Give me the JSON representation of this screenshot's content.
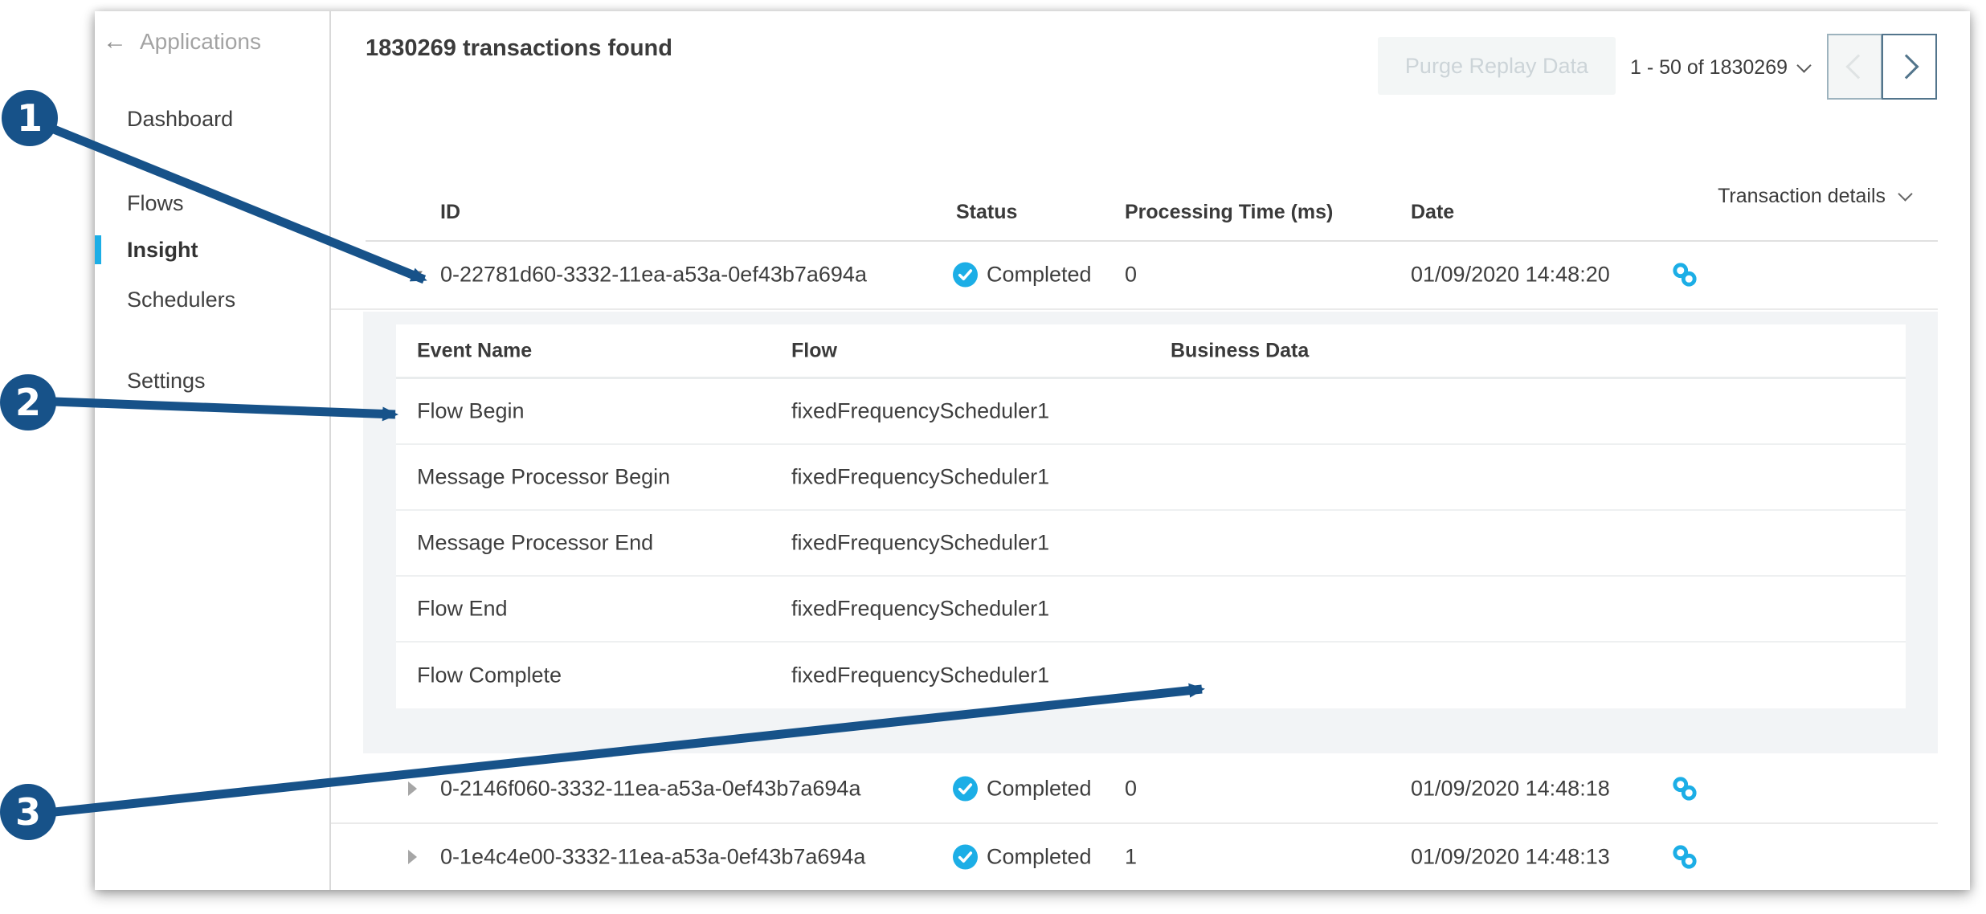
{
  "colors": {
    "accent_cyan": "#1caee6",
    "annotation_blue": "#175289",
    "status_completed_color": "#1caee6"
  },
  "icons": {
    "back": "arrow-left",
    "expand": "caret-down",
    "collapse": "caret-right",
    "status": "check-circle",
    "link": "chain-link",
    "dropdown": "chevron-down",
    "prev": "chevron-left",
    "next": "chevron-right"
  },
  "annotations": {
    "items": [
      {
        "label": "1"
      },
      {
        "label": "2"
      },
      {
        "label": "3"
      }
    ]
  },
  "sidebar": {
    "back": {
      "icon_glyph": "←",
      "label": "Applications"
    },
    "items": [
      {
        "label": "Dashboard",
        "active": false
      },
      {
        "label": "Flows",
        "active": false
      },
      {
        "label": "Insight",
        "active": true
      },
      {
        "label": "Schedulers",
        "active": false
      },
      {
        "label": "Settings",
        "active": false
      }
    ]
  },
  "toolbar": {
    "title": "1830269 transactions found",
    "purge_label": "Purge Replay Data",
    "pagination_label": "1 - 50 of 1830269"
  },
  "table": {
    "transaction_details_label": "Transaction details",
    "columns": {
      "id": "ID",
      "status": "Status",
      "processing_time": "Processing Time (ms)",
      "date": "Date"
    },
    "rows": [
      {
        "id": "0-22781d60-3332-11ea-a53a-0ef43b7a694a",
        "status": "Completed",
        "processing_time": "0",
        "date": "01/09/2020 14:48:20",
        "expanded": true
      },
      {
        "id": "0-2146f060-3332-11ea-a53a-0ef43b7a694a",
        "status": "Completed",
        "processing_time": "0",
        "date": "01/09/2020 14:48:18",
        "expanded": false
      },
      {
        "id": "0-1e4c4e00-3332-11ea-a53a-0ef43b7a694a",
        "status": "Completed",
        "processing_time": "1",
        "date": "01/09/2020 14:48:13",
        "expanded": false
      }
    ]
  },
  "events": {
    "columns": {
      "event": "Event Name",
      "flow": "Flow",
      "business_data": "Business Data"
    },
    "rows": [
      {
        "event": "Flow Begin",
        "flow": "fixedFrequencyScheduler1",
        "business_data": ""
      },
      {
        "event": "Message Processor Begin",
        "flow": "fixedFrequencyScheduler1",
        "business_data": ""
      },
      {
        "event": "Message Processor End",
        "flow": "fixedFrequencyScheduler1",
        "business_data": ""
      },
      {
        "event": "Flow End",
        "flow": "fixedFrequencyScheduler1",
        "business_data": ""
      },
      {
        "event": "Flow Complete",
        "flow": "fixedFrequencyScheduler1",
        "business_data": ""
      }
    ]
  }
}
